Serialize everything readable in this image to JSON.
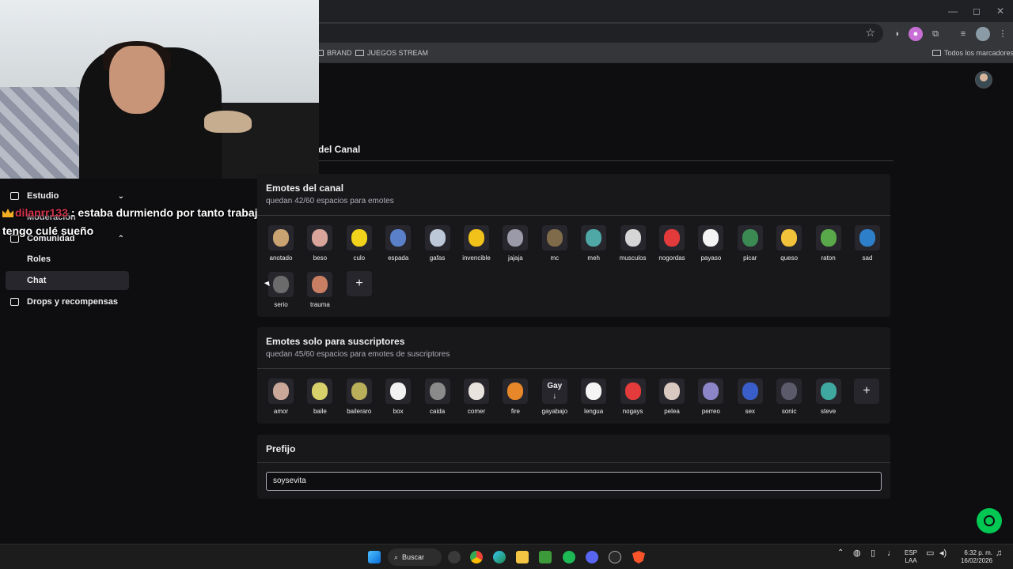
{
  "browser": {
    "bookmarks": [
      "BRAND",
      "JUEGOS STREAM"
    ],
    "all_bookmarks_label": "Todos los marcadores"
  },
  "page": {
    "heading_fragment": "del Canal"
  },
  "sidebar": {
    "items": [
      {
        "label": "Estudio",
        "chevron": "⌄"
      },
      {
        "label": "Comunidad",
        "chevron": "⌃"
      },
      {
        "label": "Moderación"
      },
      {
        "label": "Roles"
      },
      {
        "label": "Chat",
        "active": true
      },
      {
        "label": "Drops y recompensas"
      }
    ]
  },
  "overlay": {
    "username": "dilanrr133",
    "line1_rest": ": estaba durmiendo por tanto trabajo y ahora",
    "line2": "tengo culé sueño"
  },
  "channel_emotes": {
    "title": "Emotes del canal",
    "subtitle": "quedan 42/60 espacios para emotes",
    "items": [
      "anotado",
      "beso",
      "culo",
      "espada",
      "gafas",
      "invencible",
      "jajaja",
      "mc",
      "meh",
      "musculos",
      "nogordas",
      "payaso",
      "picar",
      "queso",
      "raton",
      "sad",
      "serio",
      "trauma"
    ],
    "colors": [
      "#c9a271",
      "#d9a59a",
      "#f2d31b",
      "#5a80c9",
      "#bcc8d8",
      "#f0c21a",
      "#9a9aa8",
      "#7f6b4a",
      "#4fa7a6",
      "#d6d6d6",
      "#e33b3b",
      "#f4f4f4",
      "#3b8a54",
      "#f2c23b",
      "#59a84a",
      "#2e7fc9",
      "#6b6b6b",
      "#c87e62"
    ]
  },
  "sub_emotes": {
    "title": "Emotes solo para suscriptores",
    "subtitle": "quedan 45/60 espacios para emotes de suscriptores",
    "items": [
      "amor",
      "baile",
      "baileraro",
      "box",
      "caida",
      "comer",
      "fire",
      "gayabajo",
      "lengua",
      "nogays",
      "pelea",
      "perreo",
      "sex",
      "sonic",
      "steve"
    ],
    "colors": [
      "#c9a89a",
      "#d8d06a",
      "#b9ae5a",
      "#f2f2f2",
      "#8a8a8a",
      "#e9e3dd",
      "#e8872a",
      "#26262c",
      "#f4f4f4",
      "#e33b3b",
      "#d9c8c0",
      "#8c86c9",
      "#3a5ec9",
      "#5a5a6a",
      "#3fa8a0"
    ],
    "gay_label": "Gay",
    "gay_arrow": "↓"
  },
  "prefix": {
    "title": "Prefijo",
    "value": "soysevita"
  },
  "taskbar": {
    "search_label": "Buscar",
    "lang_line1": "ESP",
    "lang_line2": "LAA",
    "time": "6:32 p. m.",
    "date": "16/02/2026"
  }
}
